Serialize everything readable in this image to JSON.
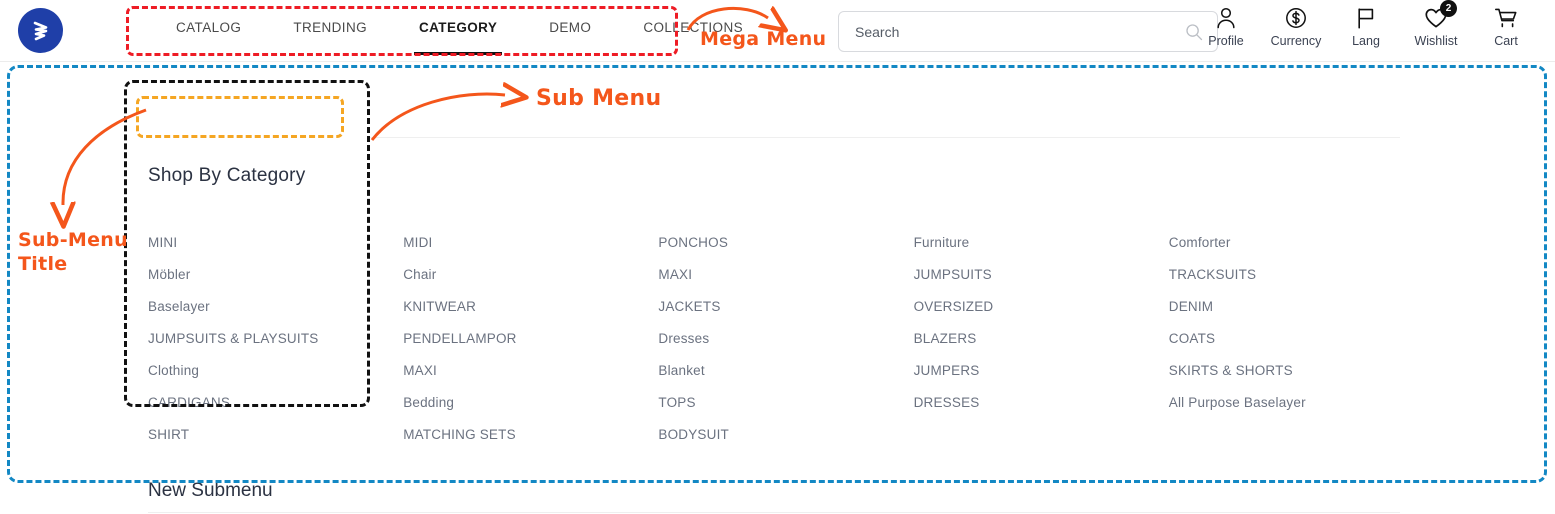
{
  "header": {
    "logo_icon": "brand-zigzag-logo",
    "nav": [
      {
        "label": "CATALOG",
        "active": false
      },
      {
        "label": "TRENDING",
        "active": false
      },
      {
        "label": "CATEGORY",
        "active": true
      },
      {
        "label": "DEMO",
        "active": false
      },
      {
        "label": "COLLECTIONS",
        "active": false
      }
    ],
    "search": {
      "value": "",
      "placeholder": "Search",
      "icon": "search-icon"
    },
    "icons": [
      {
        "label": "Profile",
        "icon": "user-icon",
        "badge": ""
      },
      {
        "label": "Currency",
        "icon": "dollar-icon",
        "badge": ""
      },
      {
        "label": "Lang",
        "icon": "flag-icon",
        "badge": ""
      },
      {
        "label": "Wishlist",
        "icon": "heart-icon",
        "badge": "2"
      },
      {
        "label": "Cart",
        "icon": "cart-icon",
        "badge": ""
      }
    ]
  },
  "mega_menu": {
    "title": "Shop By Category",
    "new_submenu_title": "New Submenu",
    "columns": [
      {
        "items": [
          "MINI",
          "Möbler",
          "Baselayer",
          "JUMPSUITS & PLAYSUITS",
          "Clothing",
          "CARDIGANS",
          "SHIRT"
        ]
      },
      {
        "items": [
          "MIDI",
          "Chair",
          "KNITWEAR",
          "PENDELLAMPOR",
          "MAXI",
          "Bedding",
          "MATCHING SETS"
        ]
      },
      {
        "items": [
          "PONCHOS",
          "MAXI",
          "JACKETS",
          "Dresses",
          "Blanket",
          "TOPS",
          "BODYSUIT"
        ]
      },
      {
        "items": [
          "Furniture",
          "JUMPSUITS",
          "OVERSIZED",
          "BLAZERS",
          "JUMPERS",
          "DRESSES"
        ]
      },
      {
        "items": [
          "Comforter",
          "TRACKSUITS",
          "DENIM",
          "COATS",
          "SKIRTS & SHORTS",
          "All Purpose Baselayer"
        ]
      }
    ]
  },
  "annotations": {
    "mega_menu_label": "Mega Menu",
    "sub_menu_label": "Sub Menu",
    "sub_menu_title_label_line1": "Sub-Menu",
    "sub_menu_title_label_line2": "Title"
  },
  "colors": {
    "brand_blue": "#1f3fa8",
    "annotation_orange": "#f4561b",
    "box_red": "#ee1c25",
    "box_blue": "#1388c4",
    "box_black": "#111111",
    "box_amber": "#f5a623"
  }
}
